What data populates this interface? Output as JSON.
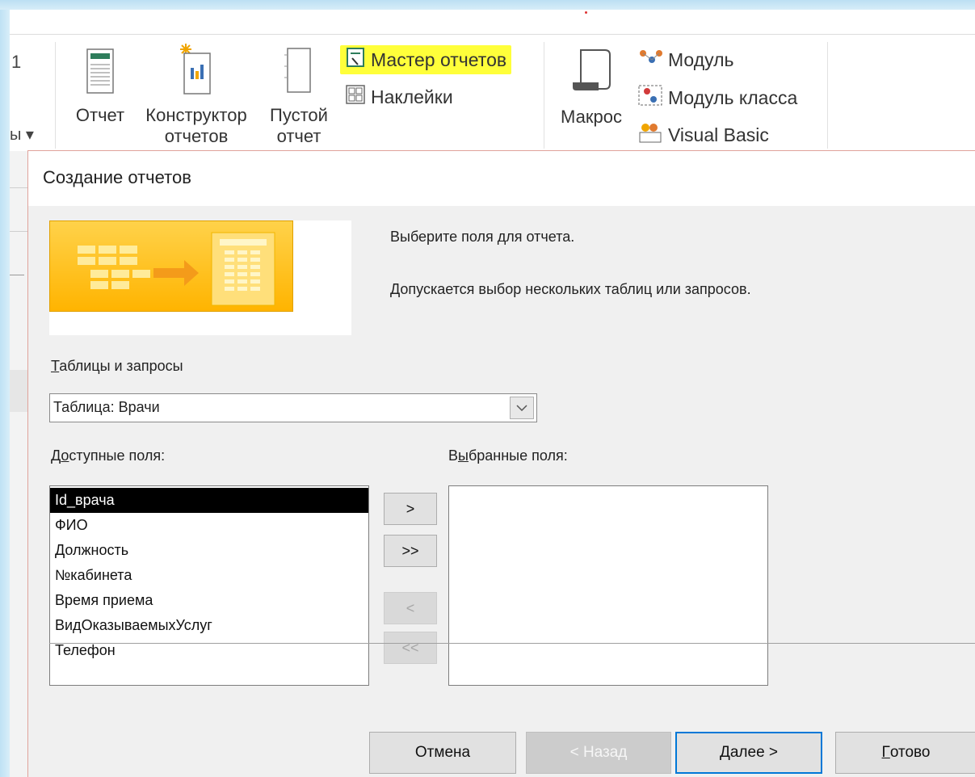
{
  "ribbon": {
    "fragment_left_top": "1",
    "fragment_left_bottom": "ы ▾",
    "report_label": "Отчет",
    "report_designer_label": "Конструктор\nотчетов",
    "blank_report_label": "Пустой\nотчет",
    "report_wizard_label": "Мастер отчетов",
    "labels_label": "Наклейки",
    "macro_label": "Макрос",
    "module_label": "Модуль",
    "class_module_label": "Модуль класса",
    "visual_basic_label": "Visual Basic",
    "highlight_color": "#ffff3a"
  },
  "dialog": {
    "title": "Создание отчетов",
    "prompt_line1": "Выберите поля для отчета.",
    "prompt_line2": "Допускается выбор нескольких таблиц или запросов.",
    "tables_label_ul": "Т",
    "tables_label_rest": "аблицы и запросы",
    "selected_table": "Таблица: Врачи",
    "available_label_pre": "Д",
    "available_label_ul": "о",
    "available_label_rest": "ступные поля:",
    "selected_label_pre": "В",
    "selected_label_ul": "ы",
    "selected_label_rest": "бранные поля:",
    "available_fields": [
      "Id_врача",
      "ФИО",
      "Должность",
      "№кабинета",
      "Время приема",
      "ВидОказываемыхУслуг",
      "Телефон"
    ],
    "selected_fields": [],
    "move": {
      "add_one": ">",
      "add_all": ">>",
      "remove_one": "<",
      "remove_all": "<<"
    },
    "buttons": {
      "cancel": "Отмена",
      "back": "< Назад",
      "next_ul": "Д",
      "next_rest": "алее >",
      "finish_ul": "Г",
      "finish_rest": "отово"
    }
  }
}
